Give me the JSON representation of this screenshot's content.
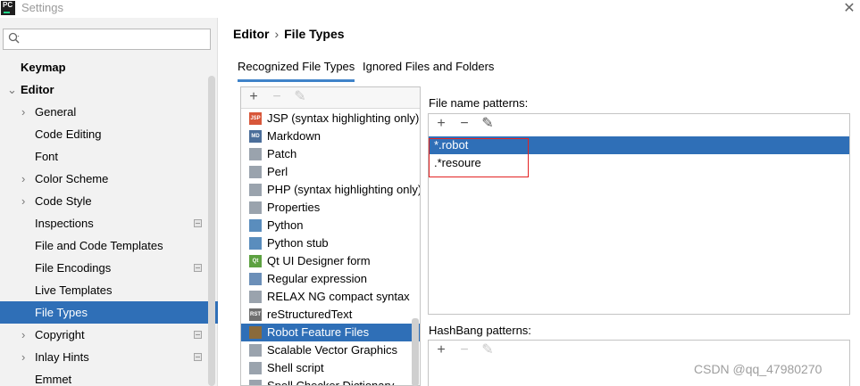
{
  "window": {
    "title": "Settings",
    "app_icon_text": "PC",
    "close_glyph": "✕"
  },
  "search": {
    "placeholder": "",
    "value": ""
  },
  "sidebar": {
    "items": [
      {
        "label": "Keymap",
        "level": "top",
        "chevron": ""
      },
      {
        "label": "Editor",
        "level": "top",
        "chevron": "⌄"
      },
      {
        "label": "General",
        "chevron": "›"
      },
      {
        "label": "Code Editing",
        "chevron": ""
      },
      {
        "label": "Font",
        "chevron": ""
      },
      {
        "label": "Color Scheme",
        "chevron": "›"
      },
      {
        "label": "Code Style",
        "chevron": "›"
      },
      {
        "label": "Inspections",
        "chevron": "",
        "badge": true
      },
      {
        "label": "File and Code Templates",
        "chevron": ""
      },
      {
        "label": "File Encodings",
        "chevron": "",
        "badge": true
      },
      {
        "label": "Live Templates",
        "chevron": ""
      },
      {
        "label": "File Types",
        "chevron": "",
        "selected": true
      },
      {
        "label": "Copyright",
        "chevron": "›",
        "badge": true
      },
      {
        "label": "Inlay Hints",
        "chevron": "›",
        "badge": true
      },
      {
        "label": "Emmet",
        "chevron": ""
      }
    ]
  },
  "breadcrumb": {
    "parent": "Editor",
    "separator": "›",
    "current": "File Types"
  },
  "tabs": [
    {
      "label": "Recognized File Types",
      "active": true
    },
    {
      "label": "Ignored Files and Folders",
      "active": false
    }
  ],
  "toolbar": {
    "add": "+",
    "remove": "−",
    "edit": "✎"
  },
  "file_types": [
    {
      "label": "JSP (syntax highlighting only)",
      "icon": "jsp-file-icon",
      "icon_text": "JSP",
      "color": "#d8573a"
    },
    {
      "label": "Markdown",
      "icon": "markdown-file-icon",
      "icon_text": "MD",
      "color": "#4b6e9a"
    },
    {
      "label": "Patch",
      "icon": "patch-file-icon",
      "icon_text": "",
      "color": "#9aa3ad"
    },
    {
      "label": "Perl",
      "icon": "perl-file-icon",
      "icon_text": "",
      "color": "#9aa3ad"
    },
    {
      "label": "PHP (syntax highlighting only)",
      "icon": "php-file-icon",
      "icon_text": "",
      "color": "#9aa3ad"
    },
    {
      "label": "Properties",
      "icon": "properties-file-icon",
      "icon_text": "",
      "color": "#9aa3ad"
    },
    {
      "label": "Python",
      "icon": "python-file-icon",
      "icon_text": "",
      "color": "#5a8dbd"
    },
    {
      "label": "Python stub",
      "icon": "python-stub-file-icon",
      "icon_text": "",
      "color": "#5a8dbd"
    },
    {
      "label": "Qt UI Designer form",
      "icon": "qt-ui-file-icon",
      "icon_text": "Qt",
      "color": "#5da141"
    },
    {
      "label": "Regular expression",
      "icon": "regex-file-icon",
      "icon_text": "",
      "color": "#6b8fb8"
    },
    {
      "label": "RELAX NG compact syntax",
      "icon": "rng-file-icon",
      "icon_text": "",
      "color": "#9aa3ad"
    },
    {
      "label": "reStructuredText",
      "icon": "rst-file-icon",
      "icon_text": "RST",
      "color": "#6f6f6f"
    },
    {
      "label": "Robot Feature Files",
      "icon": "robot-file-icon",
      "icon_text": "",
      "color": "#8a6a3b",
      "selected": true
    },
    {
      "label": "Scalable Vector Graphics",
      "icon": "svg-file-icon",
      "icon_text": "",
      "color": "#9aa3ad"
    },
    {
      "label": "Shell script",
      "icon": "shell-script-file-icon",
      "icon_text": "",
      "color": "#9aa3ad"
    },
    {
      "label": "Spell Checker Dictionary",
      "icon": "dictionary-file-icon",
      "icon_text": "",
      "color": "#9aa3ad"
    }
  ],
  "file_name_patterns": {
    "label": "File name patterns:",
    "items": [
      {
        "value": "*.robot",
        "selected": true
      },
      {
        "value": ".*resoure",
        "selected": false
      }
    ]
  },
  "hashbang_patterns": {
    "label": "HashBang patterns:"
  },
  "watermark": "CSDN @qq_47980270",
  "colors": {
    "selection": "#2f6fb7",
    "highlight_box": "#e32222",
    "tab_underline": "#4083c9"
  }
}
